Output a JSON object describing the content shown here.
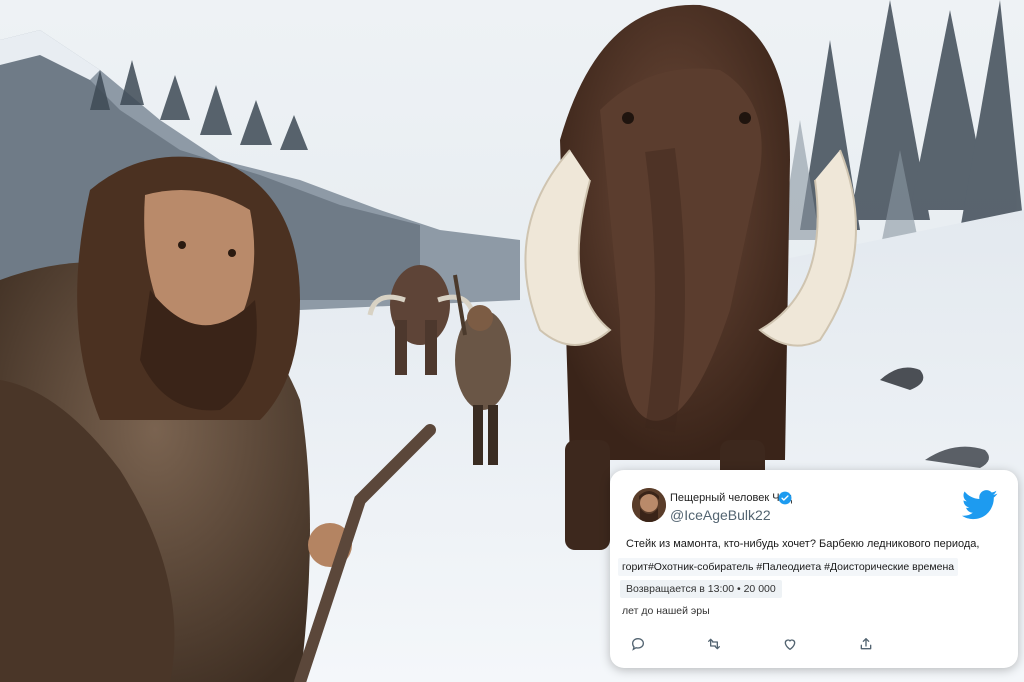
{
  "tweet": {
    "display_name": "Пещерный человек Чад",
    "handle": "@IceAgeBulk22",
    "text_line1": "Стейк из мамонта, кто-нибудь хочет? Барбекю ледникового периода,",
    "text_line2": "горит#Охотник-собиратель #Палеодиета #Доисторические времена",
    "meta": "Возвращается в 13:00 • 20 000",
    "era": "лет до нашей эры",
    "icons": {
      "platform": "twitter-bird-icon",
      "verified": "verified-badge-icon",
      "reply": "reply-icon",
      "retweet": "retweet-icon",
      "like": "heart-icon",
      "share": "share-icon"
    },
    "colors": {
      "brand": "#1d9bf0",
      "verified": "#1d9bf0",
      "icon_gray": "#536471"
    }
  }
}
